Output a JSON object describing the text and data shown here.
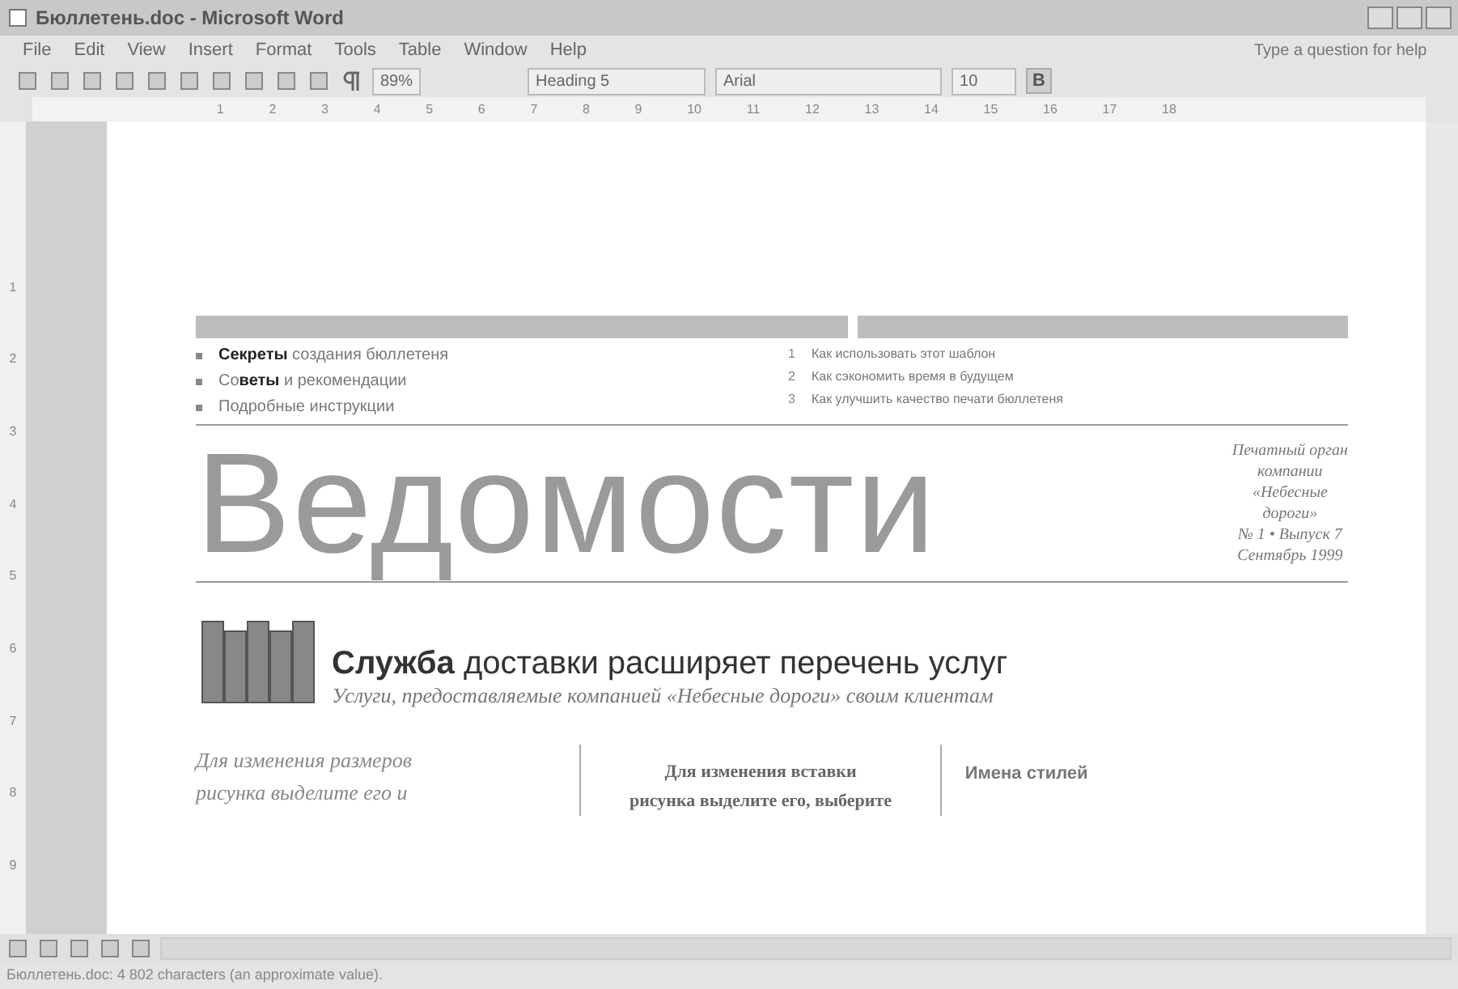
{
  "window": {
    "title": "Бюллетень.doc - Microsoft Word"
  },
  "menu": [
    "File",
    "Edit",
    "View",
    "Insert",
    "Format",
    "Tools",
    "Table",
    "Window",
    "Help"
  ],
  "help_box": {
    "placeholder": "Type a question for help"
  },
  "toolbar": {
    "zoom": "89%",
    "style": "Heading 5",
    "font": "Arial",
    "size": "10",
    "bold_label": "B",
    "bold_on": true
  },
  "ruler": {
    "horizontal": [
      "1",
      "2",
      "3",
      "4",
      "5",
      "6",
      "7",
      "8",
      "9",
      "10",
      "11",
      "12",
      "13",
      "14",
      "15",
      "16",
      "17",
      "18"
    ],
    "vertical": [
      "1",
      "2",
      "3",
      "4",
      "5",
      "6",
      "7",
      "8",
      "9"
    ]
  },
  "document": {
    "bullets": [
      "**Секреты** создания бюллетеня",
      "Со**веты** и рекомендации",
      "Подробные инструкции"
    ],
    "numbered": [
      {
        "number": "1",
        "text": "Как использовать этот шаблон"
      },
      {
        "number": "2",
        "text": "Как сэкономить время в будущем"
      },
      {
        "number": "3",
        "text": "Как улучшить качество печати бюллетеня"
      }
    ],
    "masthead": "Ведомости",
    "masthead_side": [
      "Печатный орган",
      "компании",
      "«Небесные",
      "дороги»",
      "№ 1 • Выпуск 7",
      "Сентябрь 1999"
    ],
    "headline": "**Служба** доставки расширяет перечень услуг",
    "subheadline": "Услуги, предоставляемые компанией «Небесные дороги» своим клиентам",
    "column_1": [
      "Для изменения размеров",
      "рисунка выделите его и"
    ],
    "column_2": [
      "Для изменения вставки",
      "рисунка выделите его, выберите"
    ],
    "column_3": "Имена стилей"
  },
  "status_bar": "Бюллетень.doc: 4 802 characters (an approximate value)."
}
